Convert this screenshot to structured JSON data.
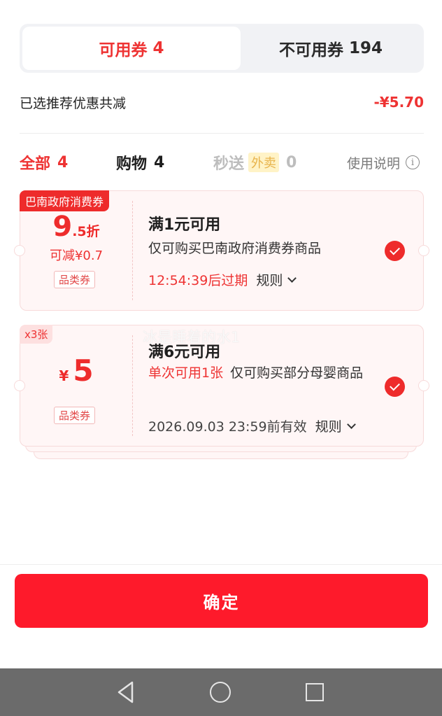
{
  "tabs": {
    "available": {
      "label": "可用券",
      "count": "4"
    },
    "unavailable": {
      "label": "不可用券",
      "count": "194"
    }
  },
  "summary": {
    "label": "已选推荐优惠共减",
    "value": "-¥5.70"
  },
  "filters": {
    "all": {
      "label": "全部",
      "count": "4"
    },
    "shopping": {
      "label": "购物",
      "count": "4"
    },
    "fast": {
      "label": "秒送",
      "badge": "外卖",
      "count": "0"
    },
    "help_label": "使用说明",
    "help_icon": "info-icon"
  },
  "coupons": [
    {
      "corner_tag": "巴南政府消费券",
      "discount_number": "9",
      "discount_suffix": ".5折",
      "sub_text": "可减¥0.7",
      "category_tag": "品类券",
      "title": "满1元可用",
      "description": "仅可购买巴南政府消费券商品",
      "expiry": "12:54:39后过期",
      "rule_label": "规则",
      "selected": true
    },
    {
      "corner_tag": "x3张",
      "currency": "¥",
      "amount": "5",
      "category_tag": "品类券",
      "title": "满6元可用",
      "highlight": "单次可用1张",
      "description": "仅可购买部分母婴商品",
      "expiry": "2026.09.03 23:59前有效",
      "rule_label": "规则",
      "selected": true
    }
  ],
  "watermark": "冰是睡着的水1",
  "confirm_label": "确定",
  "colors": {
    "accent": "#ee2b2b",
    "button": "#fe1a2b",
    "card_bg": "#fff6f6"
  },
  "system_nav": [
    "back-icon",
    "home-icon",
    "recent-apps-icon"
  ]
}
